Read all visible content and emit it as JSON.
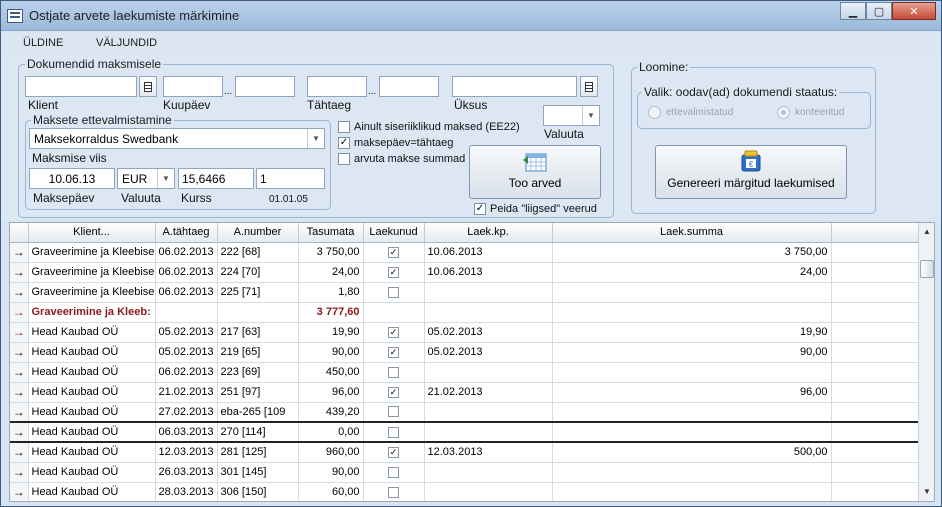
{
  "window": {
    "title": "Ostjate arvete laekumiste märkimine"
  },
  "menu": {
    "items": [
      "ÜLDINE",
      "VÄLJUNDID"
    ]
  },
  "filters": {
    "legend": "Dokumendid maksmisele",
    "klient_label": "Klient",
    "kuupaev_label": "Kuupäev",
    "tahtaeg_label": "Tähtaeg",
    "uksus_label": "Üksus",
    "valuuta_label": "Valuuta",
    "range_sep": "..."
  },
  "payment": {
    "legend": "Maksete ettevalmistamine",
    "method": "Maksekorraldus Swedbank",
    "viis_label": "Maksmise viis",
    "date": "10.06.13",
    "currency": "EUR",
    "rate": "15,6466",
    "count": "1",
    "date_label": "Maksepäev",
    "currency_label": "Valuuta",
    "rate_label": "Kurss",
    "rate_date": "01.01.05"
  },
  "options": {
    "only_serial": {
      "label": "Ainult siseriiklikud maksed (EE22)",
      "checked": false
    },
    "payday_due": {
      "label": "maksepäev=tähtaeg",
      "checked": true
    },
    "calc_sum": {
      "label": "arvuta makse summad",
      "checked": false
    },
    "fetch_button": "Too arved",
    "hide_cols": {
      "label": "Peida \"liigsed\" veerud",
      "checked": true
    }
  },
  "create": {
    "legend": "Loomine:",
    "status_legend": "Valik: oodav(ad) dokumendi staatus:",
    "radio_prepared": "ettevalmistatud",
    "radio_posted": "konteeritud",
    "generate_button": "Genereeri märgitud laekumised"
  },
  "grid": {
    "columns": [
      "Klient...",
      "A.tähtaeg",
      "A.number",
      "Tasumata",
      "Laekunud",
      "Laek.kp.",
      "Laek.summa"
    ],
    "rows": [
      {
        "client": "Graveerimine ja Kleebise",
        "due": "06.02.2013",
        "num": "222 [68]",
        "unpaid": "3 750,00",
        "received": true,
        "recv_date": "10.06.2013",
        "recv_sum": "3 750,00"
      },
      {
        "client": "Graveerimine ja Kleebise",
        "due": "06.02.2013",
        "num": "224 [70]",
        "unpaid": "24,00",
        "received": true,
        "recv_date": "10.06.2013",
        "recv_sum": "24,00"
      },
      {
        "client": "Graveerimine ja Kleebise",
        "due": "06.02.2013",
        "num": "225 [71]",
        "unpaid": "1,80",
        "received": false,
        "recv_date": "",
        "recv_sum": ""
      },
      {
        "client": "Graveerimine ja Kleeb:",
        "due": "",
        "num": "",
        "unpaid": "3 777,60",
        "received": null,
        "recv_date": "",
        "recv_sum": "",
        "sum": true
      },
      {
        "client": "Head Kaubad OÜ",
        "due": "05.02.2013",
        "num": "217 [63]",
        "unpaid": "19,90",
        "received": true,
        "recv_date": "05.02.2013",
        "recv_sum": "19,90"
      },
      {
        "client": "Head Kaubad OÜ",
        "due": "05.02.2013",
        "num": "219 [65]",
        "unpaid": "90,00",
        "received": true,
        "recv_date": "05.02.2013",
        "recv_sum": "90,00"
      },
      {
        "client": "Head Kaubad OÜ",
        "due": "06.02.2013",
        "num": "223 [69]",
        "unpaid": "450,00",
        "received": false,
        "recv_date": "",
        "recv_sum": ""
      },
      {
        "client": "Head Kaubad OÜ",
        "due": "21.02.2013",
        "num": "251 [97]",
        "unpaid": "96,00",
        "received": true,
        "recv_date": "21.02.2013",
        "recv_sum": "96,00"
      },
      {
        "client": "Head Kaubad OÜ",
        "due": "27.02.2013",
        "num": "eba-265 [109",
        "unpaid": "439,20",
        "received": false,
        "recv_date": "",
        "recv_sum": ""
      },
      {
        "client": "Head Kaubad OÜ",
        "due": "06.03.2013",
        "num": "270 [114]",
        "unpaid": "0,00",
        "received": false,
        "recv_date": "",
        "recv_sum": "",
        "selected": true
      },
      {
        "client": "Head Kaubad OÜ",
        "due": "12.03.2013",
        "num": "281 [125]",
        "unpaid": "960,00",
        "received": true,
        "recv_date": "12.03.2013",
        "recv_sum": "500,00"
      },
      {
        "client": "Head Kaubad OÜ",
        "due": "26.03.2013",
        "num": "301 [145]",
        "unpaid": "90,00",
        "received": false,
        "recv_date": "",
        "recv_sum": ""
      },
      {
        "client": "Head Kaubad OÜ",
        "due": "28.03.2013",
        "num": "306 [150]",
        "unpaid": "60,00",
        "received": false,
        "recv_date": "",
        "recv_sum": ""
      }
    ]
  }
}
